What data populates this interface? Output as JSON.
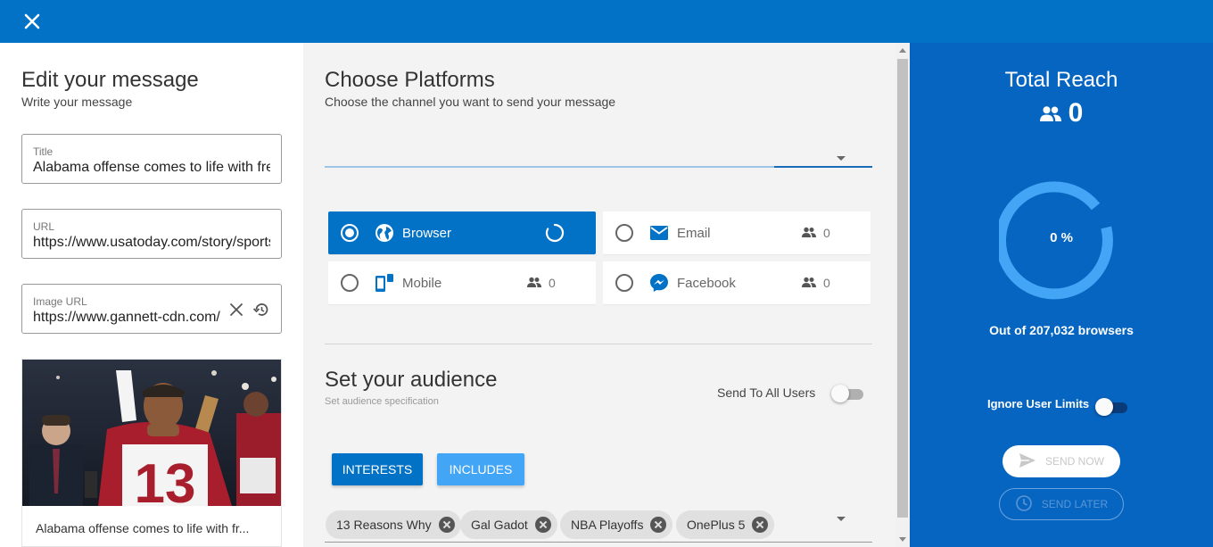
{
  "header": {
    "close_icon": "close-icon",
    "color": "#0272c6"
  },
  "editor": {
    "title": "Edit your message",
    "subtitle": "Write your message",
    "fields": {
      "title": {
        "label": "Title",
        "value": "Alabama offense comes to life with freshman"
      },
      "url": {
        "label": "URL",
        "value": "https://www.usatoday.com/story/sports/ncaaf"
      },
      "image_url": {
        "label": "Image URL",
        "value": "https://www.gannett-cdn.com/"
      }
    },
    "preview": {
      "caption": "Alabama offense comes to life with fr..."
    }
  },
  "platforms": {
    "title": "Choose Platforms",
    "subtitle": "Choose the channel you want to send your message",
    "items": [
      {
        "name": "Browser",
        "icon": "globe-icon",
        "selected": true,
        "status": "loading"
      },
      {
        "name": "Email",
        "icon": "email-icon",
        "selected": false,
        "count": "0"
      },
      {
        "name": "Mobile",
        "icon": "mobile-icon",
        "selected": false,
        "count": "0"
      },
      {
        "name": "Facebook",
        "icon": "messenger-icon",
        "selected": false,
        "count": "0"
      }
    ]
  },
  "audience": {
    "title": "Set your audience",
    "subtitle": "Set audience specification",
    "send_all_label": "Send To All Users",
    "send_all_on": false,
    "buttons": {
      "interests": "INTERESTS",
      "includes": "INCLUDES"
    },
    "chips": [
      "13 Reasons Why",
      "Gal Gadot",
      "NBA Playoffs",
      "OnePlus 5"
    ]
  },
  "reach": {
    "title": "Total Reach",
    "value": "0",
    "percent_label": "0 %",
    "progress": 0,
    "out_of": "Out of 207,032 browsers",
    "ignore_limits_label": "Ignore User Limits",
    "ignore_limits_on": false,
    "send_now": "SEND NOW",
    "send_later": "SEND LATER"
  },
  "colors": {
    "primary": "#0272c6",
    "reach_panel": "#0665c1",
    "gauge": "#42a5f5",
    "includes_btn": "#42a5f5"
  }
}
